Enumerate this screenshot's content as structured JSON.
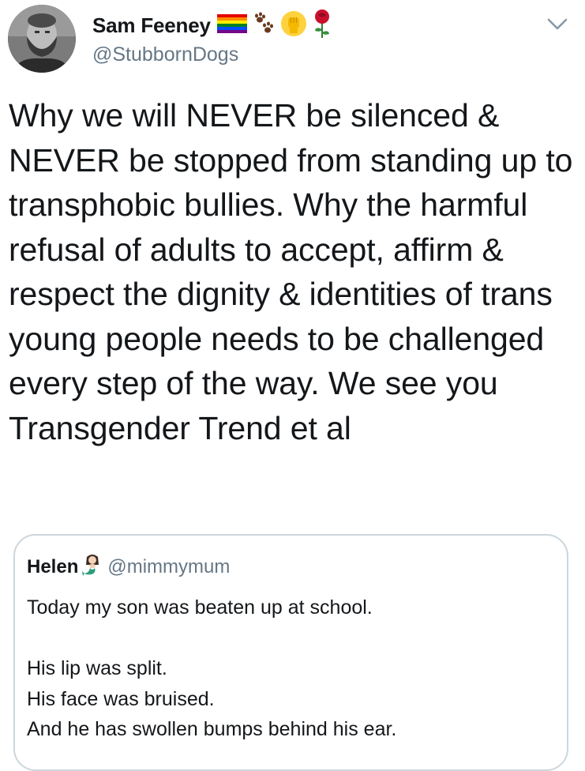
{
  "author": {
    "display_name": "Sam Feeney",
    "handle": "@StubbornDogs",
    "name_icons": [
      "rainbow-flag-icon",
      "paw-prints-icon",
      "raised-fist-icon",
      "rose-icon"
    ]
  },
  "menu": {
    "icon": "chevron-down-icon"
  },
  "tweet": {
    "text": "Why we will NEVER be silenced & NEVER be stopped from standing up to transphobic bullies. Why the harmful refusal of adults to accept, affirm & respect the dignity & identities of trans young people needs to be challenged every step of the way. We see you Transgender Trend et al"
  },
  "quote": {
    "display_name": "Helen",
    "name_icon": "mermaid-icon",
    "handle": "@mimmymum",
    "lines": [
      "Today my son was beaten up at school.",
      "",
      "His lip was split.",
      "His face was bruised.",
      "And he has swollen bumps behind his ear."
    ]
  },
  "colors": {
    "text": "#14171a",
    "secondary_text": "#657786",
    "border": "#ccd6dd",
    "rose": "#c8102e",
    "fist": "#fdd23e"
  }
}
